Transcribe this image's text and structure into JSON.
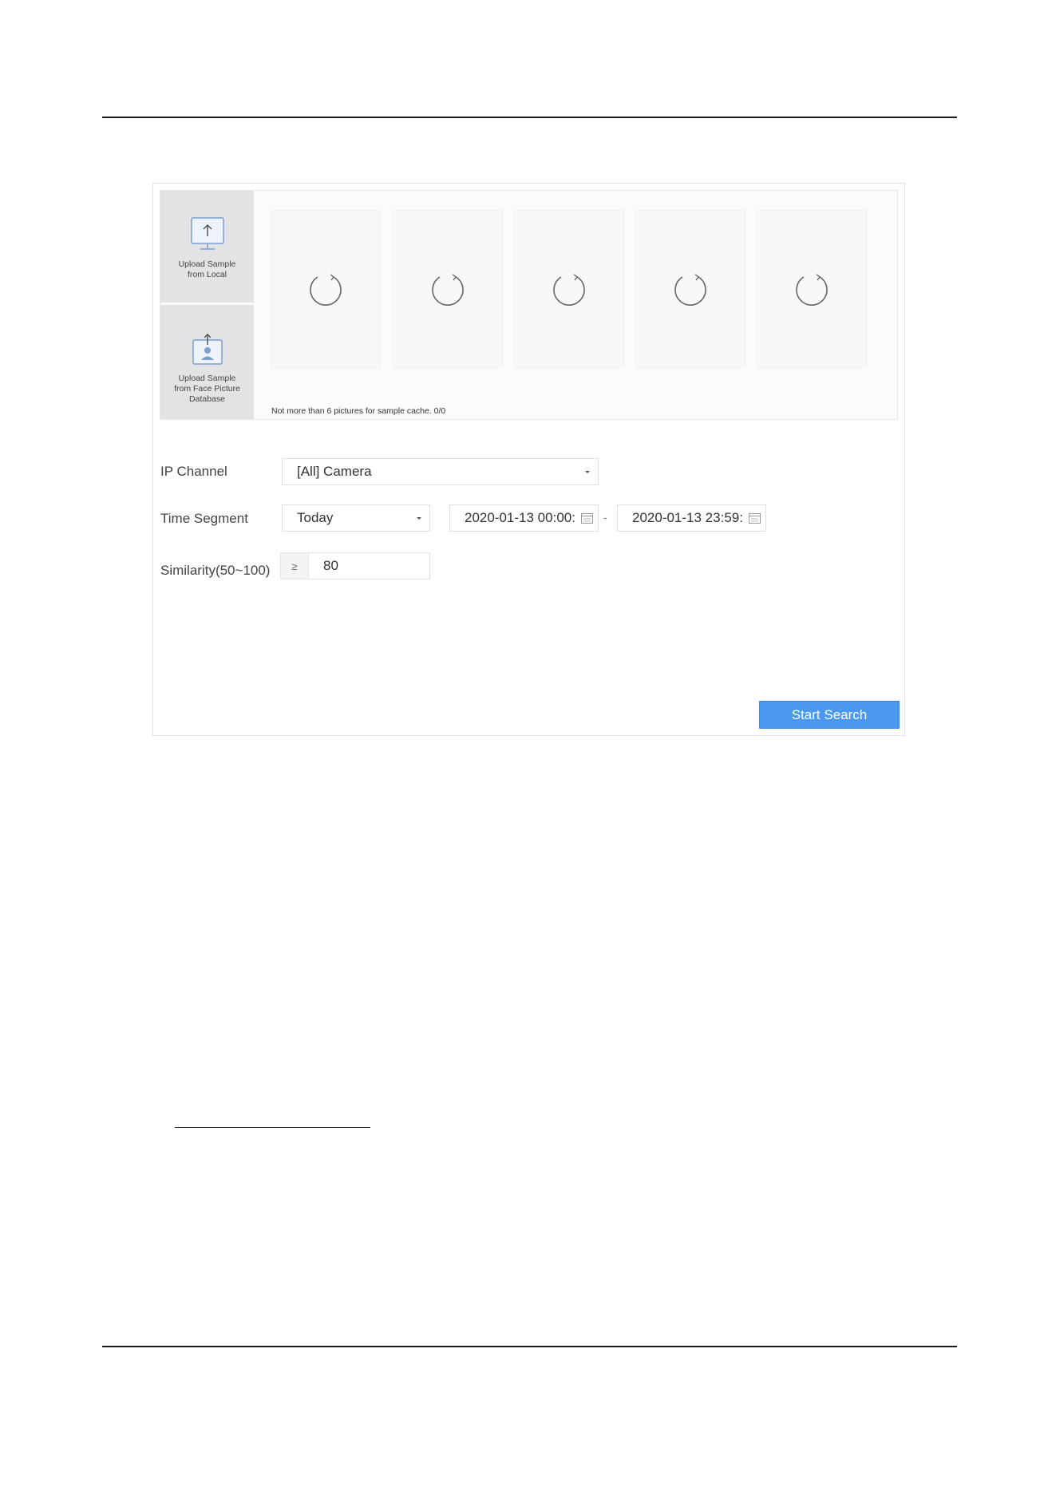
{
  "upload": {
    "local_label": "Upload Sample from Local",
    "database_label": "Upload Sample from Face Picture Database"
  },
  "sample_slots": [
    {
      "icon": "loading-spinner-icon"
    },
    {
      "icon": "loading-spinner-icon"
    },
    {
      "icon": "loading-spinner-icon"
    },
    {
      "icon": "loading-spinner-icon"
    },
    {
      "icon": "loading-spinner-icon"
    }
  ],
  "cache_note": "Not more than 6 pictures for sample cache. 0/0",
  "form": {
    "ip_channel": {
      "label": "IP Channel",
      "value": "[All] Camera"
    },
    "time_segment": {
      "label": "Time Segment",
      "value": "Today",
      "start": "2020-01-13 00:00:",
      "end": "2020-01-13 23:59:",
      "separator": "-"
    },
    "similarity": {
      "label": "Similarity(50~100)",
      "operator": "≥",
      "value": "80"
    }
  },
  "start_button": "Start Search",
  "colors": {
    "accent": "#4a98ef",
    "tile_bg": "#e3e3e6",
    "icon_blue": "#7a9fd1"
  }
}
